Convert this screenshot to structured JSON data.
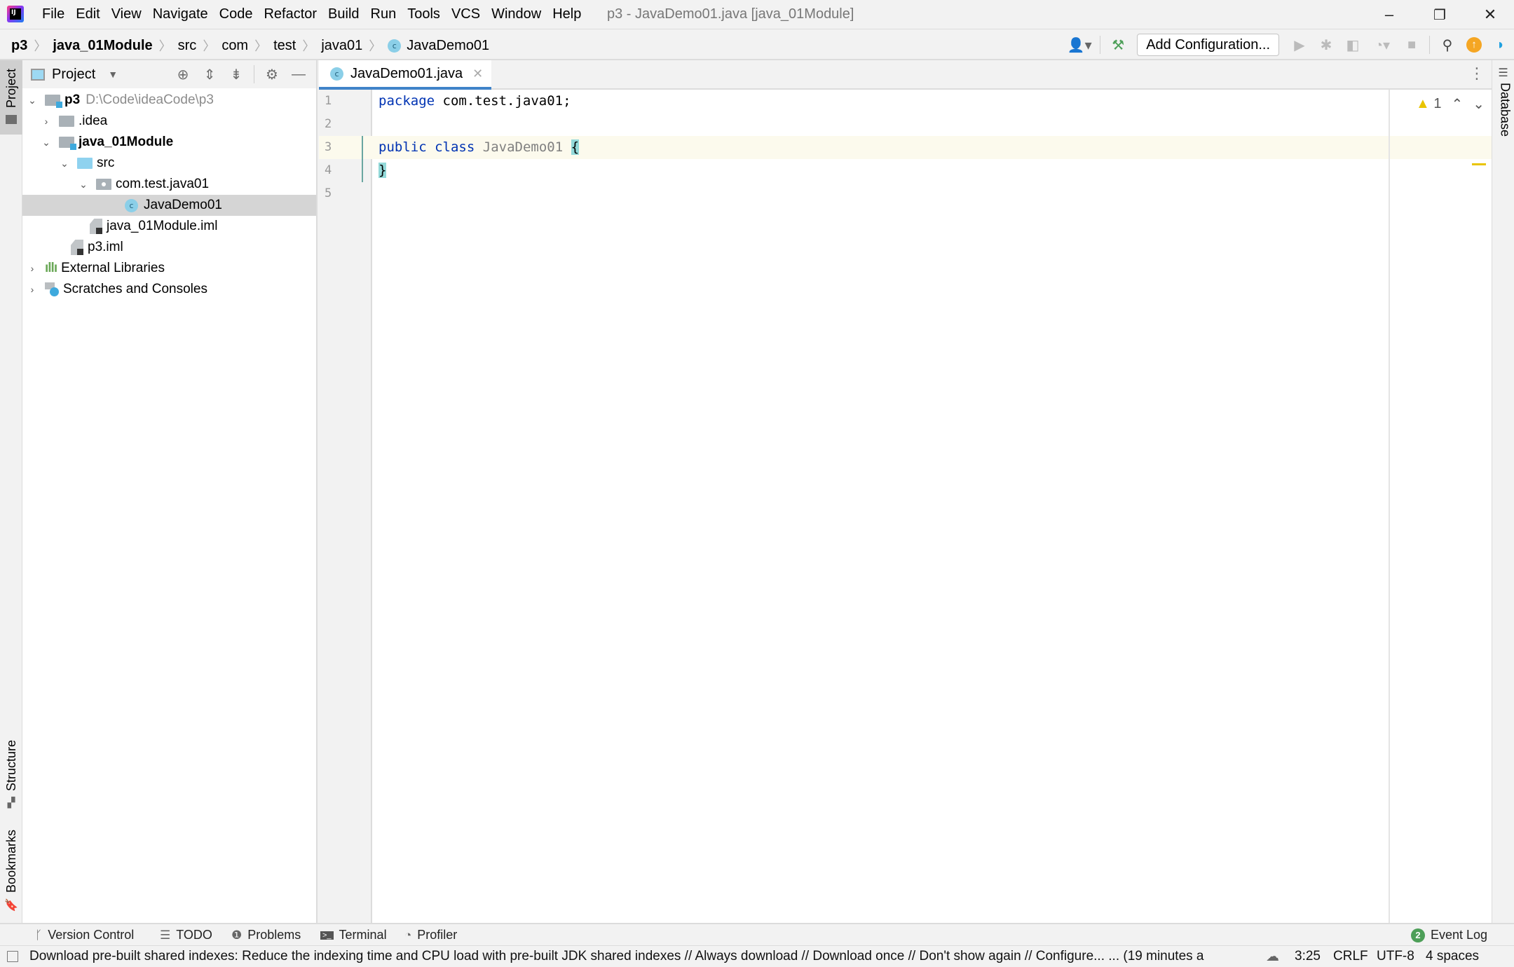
{
  "window": {
    "title": "p3 - JavaDemo01.java [java_01Module]",
    "controls": {
      "minimize": "–",
      "restore": "❐",
      "close": "✕"
    }
  },
  "menu": [
    "File",
    "Edit",
    "View",
    "Navigate",
    "Code",
    "Refactor",
    "Build",
    "Run",
    "Tools",
    "VCS",
    "Window",
    "Help"
  ],
  "breadcrumb": [
    "p3",
    "java_01Module",
    "src",
    "com",
    "test",
    "java01",
    "JavaDemo01"
  ],
  "toolbar": {
    "add_configuration": "Add Configuration...",
    "icons": [
      "account-icon",
      "build-hammer-icon",
      "run-icon",
      "debug-icon",
      "coverage-icon",
      "profile-icon",
      "stop-icon",
      "search-icon",
      "update-icon",
      "toolbox-icon"
    ]
  },
  "left_strip": {
    "project": "Project",
    "structure": "Structure",
    "bookmarks": "Bookmarks"
  },
  "right_strip": {
    "database": "Database"
  },
  "project_panel": {
    "title": "Project",
    "tree": [
      {
        "label": "p3",
        "hint": "D:\\Code\\ideaCode\\p3",
        "depth": 0,
        "expanded": true,
        "type": "module-folder",
        "bold": true
      },
      {
        "label": ".idea",
        "depth": 1,
        "expanded": false,
        "type": "folder"
      },
      {
        "label": "java_01Module",
        "depth": 1,
        "expanded": true,
        "type": "module-folder",
        "bold": true
      },
      {
        "label": "src",
        "depth": 2,
        "expanded": true,
        "type": "source-folder"
      },
      {
        "label": "com.test.java01",
        "depth": 3,
        "expanded": true,
        "type": "package"
      },
      {
        "label": "JavaDemo01",
        "depth": 4,
        "type": "class",
        "selected": true
      },
      {
        "label": "java_01Module.iml",
        "depth": 3,
        "type": "iml"
      },
      {
        "label": "p3.iml",
        "depth": 2,
        "type": "iml"
      },
      {
        "label": "External Libraries",
        "depth": 0,
        "expanded": false,
        "type": "libraries"
      },
      {
        "label": "Scratches and Consoles",
        "depth": 0,
        "expanded": false,
        "type": "scratches"
      }
    ]
  },
  "editor": {
    "tab": "JavaDemo01.java",
    "line_numbers": [
      "1",
      "2",
      "3",
      "4",
      "5"
    ],
    "code": {
      "l1_kw": "package",
      "l1_rest": " com.test.java01;",
      "l3_kw1": "public",
      "l3_kw2": "class",
      "l3_cls": "JavaDemo01",
      "l3_brace": "{",
      "l4_brace": "}"
    },
    "warnings_count": "1"
  },
  "tool_windows": [
    {
      "label": "Version Control",
      "icon": "version-control-icon"
    },
    {
      "label": "TODO",
      "icon": "todo-icon"
    },
    {
      "label": "Problems",
      "icon": "problems-icon"
    },
    {
      "label": "Terminal",
      "icon": "terminal-icon"
    },
    {
      "label": "Profiler",
      "icon": "profiler-icon"
    }
  ],
  "event_log": {
    "label": "Event Log",
    "count": "2"
  },
  "status_bar": {
    "message": "Download pre-built shared indexes: Reduce the indexing time and CPU load with pre-built JDK shared indexes // Always download // Download once // Don't show again // Configure... ... (19 minutes a",
    "caret": "3:25",
    "line_sep": "CRLF",
    "encoding": "UTF-8",
    "indent": "4 spaces"
  },
  "colors": {
    "keyword": "#0033b3",
    "class_name": "#808080",
    "brace_match": "#93d9d9",
    "tab_underline": "#4083c9",
    "warning": "#e9c400",
    "event_badge": "#4d9f58"
  }
}
